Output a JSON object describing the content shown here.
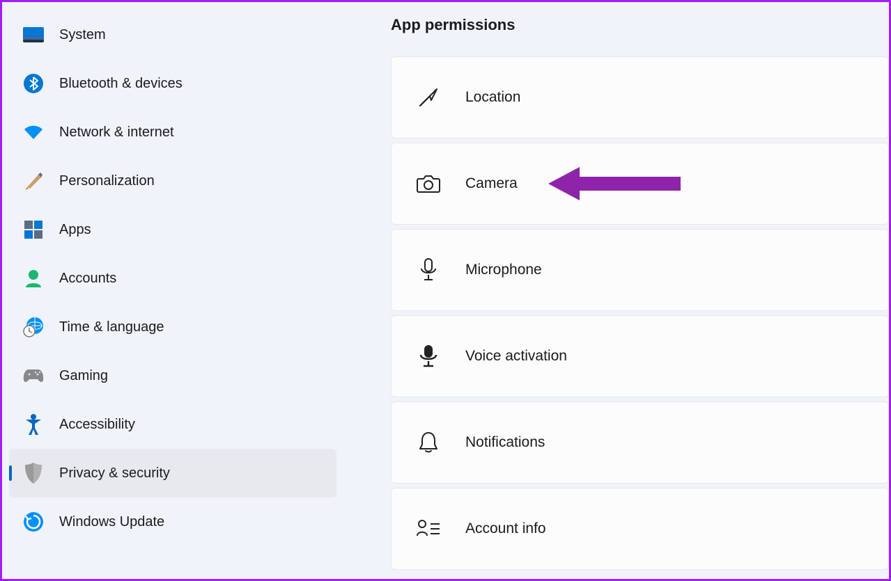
{
  "sidebar": {
    "items": [
      {
        "label": "System"
      },
      {
        "label": "Bluetooth & devices"
      },
      {
        "label": "Network & internet"
      },
      {
        "label": "Personalization"
      },
      {
        "label": "Apps"
      },
      {
        "label": "Accounts"
      },
      {
        "label": "Time & language"
      },
      {
        "label": "Gaming"
      },
      {
        "label": "Accessibility"
      },
      {
        "label": "Privacy & security"
      },
      {
        "label": "Windows Update"
      }
    ]
  },
  "main": {
    "title": "App permissions",
    "cards": [
      {
        "label": "Location"
      },
      {
        "label": "Camera"
      },
      {
        "label": "Microphone"
      },
      {
        "label": "Voice activation"
      },
      {
        "label": "Notifications"
      },
      {
        "label": "Account info"
      }
    ]
  }
}
